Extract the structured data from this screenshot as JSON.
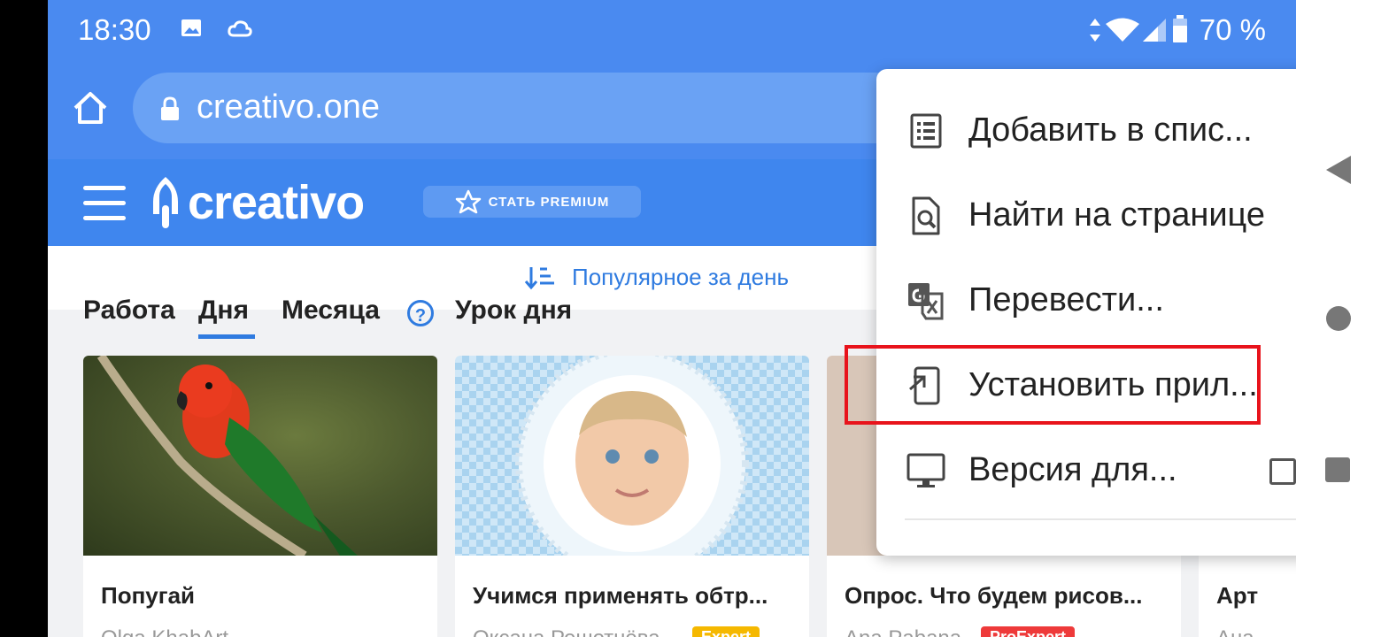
{
  "status_bar": {
    "time": "18:30",
    "battery": "70 %",
    "icons": [
      "image-icon",
      "cloud-icon",
      "data-arrows-icon",
      "wifi-icon",
      "signal-icon",
      "battery-icon"
    ]
  },
  "browser": {
    "url": "creativo.one"
  },
  "site": {
    "logo_text": "creativo",
    "premium_label": "СТАТЬ PREMIUM",
    "sort_label": "Популярное за день",
    "tabs": [
      {
        "label": "Работа"
      },
      {
        "label": "Дня"
      },
      {
        "label": "Месяца"
      },
      {
        "label": "Урок дня"
      }
    ],
    "help_label": "?"
  },
  "cards": [
    {
      "title": "Попугай",
      "author": "Olga KhabArt",
      "badge": ""
    },
    {
      "title": "Учимся применять обтр...",
      "author": "Оксана Решетнёва",
      "badge": "Expert"
    },
    {
      "title": "Опрос. Что будем рисов...",
      "author": "Ana Pabana",
      "badge": "ProExpert"
    },
    {
      "title": "Арт",
      "author": "Ана",
      "badge": ""
    }
  ],
  "menu": {
    "items": [
      {
        "label": "Добавить в спис...",
        "icon": "list-icon"
      },
      {
        "label": "Найти на странице",
        "icon": "find-in-page-icon"
      },
      {
        "label": "Перевести...",
        "icon": "translate-icon"
      },
      {
        "label": "Установить прил...",
        "icon": "install-app-icon"
      },
      {
        "label": "Версия для...",
        "icon": "desktop-icon"
      }
    ]
  },
  "colors": {
    "chrome_blue": "#4a8af0",
    "site_blue": "#3f86ee",
    "accent": "#2f7be0",
    "highlight_red": "#e8131b",
    "badge_expert": "#f5b800",
    "badge_proexpert": "#ee3a3a"
  }
}
